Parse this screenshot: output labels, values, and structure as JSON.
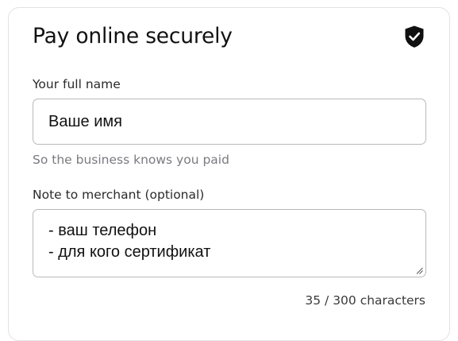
{
  "form": {
    "title": "Pay online securely",
    "title_icon": "shield-check-icon",
    "name_label": "Your full name",
    "name_value": "Ваше имя",
    "name_hint": "So the business knows you paid",
    "note_label": "Note to merchant (optional)",
    "note_lines": [
      "- ваш телефон",
      "- для кого сертификат"
    ],
    "counter": "35 / 300 characters"
  },
  "colors": {
    "border": "#e2e2e6",
    "field_border": "#b9b9be",
    "hint": "#7a7a80",
    "icon": "#111111"
  }
}
